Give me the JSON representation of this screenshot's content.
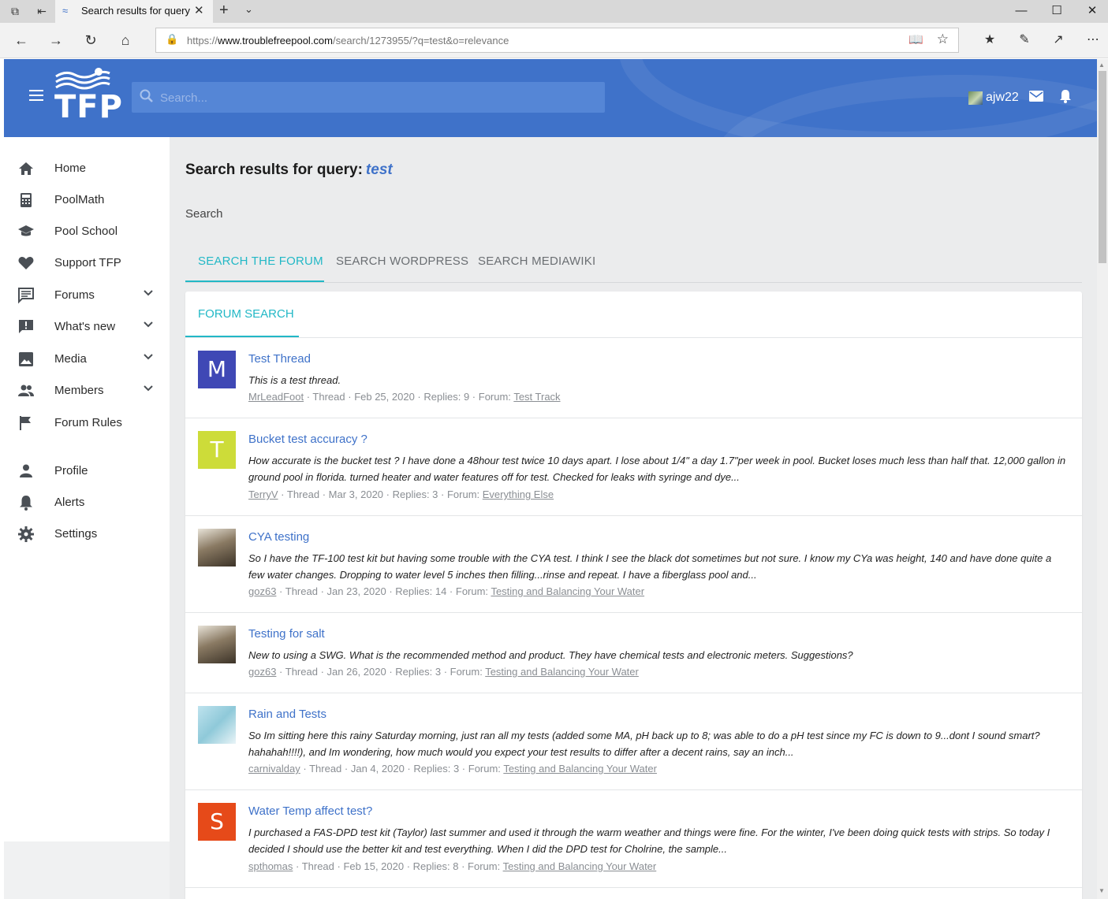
{
  "browser": {
    "tab_title": "Search results for query",
    "url_prefix": "https://",
    "url_domain": "www.troublefreepool.com",
    "url_path": "/search/1273955/?q=test&o=relevance"
  },
  "header": {
    "logo_text": "TFP",
    "search_placeholder": "Search...",
    "username": "ajw22"
  },
  "sidebar": {
    "items": [
      {
        "label": "Home",
        "icon": "home-icon"
      },
      {
        "label": "PoolMath",
        "icon": "calculator-icon"
      },
      {
        "label": "Pool School",
        "icon": "graduation-cap-icon"
      },
      {
        "label": "Support TFP",
        "icon": "heart-icon"
      },
      {
        "label": "Forums",
        "icon": "forum-icon"
      },
      {
        "label": "What's new",
        "icon": "whats-new-icon"
      },
      {
        "label": "Media",
        "icon": "image-icon"
      },
      {
        "label": "Members",
        "icon": "members-icon"
      },
      {
        "label": "Forum Rules",
        "icon": "flag-icon"
      },
      {
        "label": "Profile",
        "icon": "person-icon"
      },
      {
        "label": "Alerts",
        "icon": "bell-icon"
      },
      {
        "label": "Settings",
        "icon": "gear-icon"
      }
    ]
  },
  "main": {
    "title": "Search results for query:",
    "query": "test",
    "search_label": "Search",
    "tabs": [
      "SEARCH THE FORUM",
      "SEARCH WORDPRESS",
      "SEARCH MEDIAWIKI"
    ],
    "panel_tab": "FORUM SEARCH"
  },
  "results": [
    {
      "avatar_letter": "M",
      "avatar_color": "#3f48b5",
      "title": "Test Thread",
      "snippet": "This is a test thread.",
      "author": "MrLeadFoot",
      "type": "Thread",
      "date": "Feb 25, 2020",
      "replies": "Replies: 9",
      "forum_label": "Forum:",
      "forum": "Test Track"
    },
    {
      "avatar_letter": "T",
      "avatar_color": "#cddc39",
      "title": "Bucket test accuracy ?",
      "snippet": "How accurate is the bucket test ? I have done a 48hour test twice 10 days apart. I lose about 1/4\" a day 1.7\"per week in pool. Bucket loses much less than half that. 12,000 gallon in ground pool in florida. turned heater and water features off for test. Checked for leaks with syringe and dye...",
      "author": "TerryV",
      "type": "Thread",
      "date": "Mar 3, 2020",
      "replies": "Replies: 3",
      "forum_label": "Forum:",
      "forum": "Everything Else"
    },
    {
      "avatar_letter": "",
      "avatar_color": "#6b5b45",
      "title": "CYA testing",
      "snippet": "So I have the TF-100 test kit but having some trouble with the CYA test. I think I see the black dot sometimes but not sure. I know my CYa was height, 140 and have done quite a few water changes. Dropping to water level 5 inches then filling...rinse and repeat. I have a fiberglass pool and...",
      "author": "goz63",
      "type": "Thread",
      "date": "Jan 23, 2020",
      "replies": "Replies: 14",
      "forum_label": "Forum:",
      "forum": "Testing and Balancing Your Water"
    },
    {
      "avatar_letter": "",
      "avatar_color": "#6b5b45",
      "title": "Testing for salt",
      "snippet": "New to using a SWG. What is the recommended method and product. They have chemical tests and electronic meters. Suggestions?",
      "author": "goz63",
      "type": "Thread",
      "date": "Jan 26, 2020",
      "replies": "Replies: 3",
      "forum_label": "Forum:",
      "forum": "Testing and Balancing Your Water"
    },
    {
      "avatar_letter": "",
      "avatar_color": "#8fc9d9",
      "title": "Rain and Tests",
      "snippet": "So Im sitting here this rainy Saturday morning, just ran all my tests (added some MA, pH back up to 8; was able to do a pH test since my FC is down to 9...dont I sound smart? hahahah!!!!), and Im wondering, how much would you expect your test results to differ after a decent rains, say an inch...",
      "author": "carnivalday",
      "type": "Thread",
      "date": "Jan 4, 2020",
      "replies": "Replies: 3",
      "forum_label": "Forum:",
      "forum": "Testing and Balancing Your Water"
    },
    {
      "avatar_letter": "S",
      "avatar_color": "#e64a19",
      "title": "Water Temp affect test?",
      "snippet": "I purchased a FAS-DPD test kit (Taylor) last summer and used it through the warm weather and things were fine. For the winter, I've been doing quick tests with strips. So today I decided I should use the better kit and test everything. When I did the DPD test for Cholrine, the sample...",
      "author": "spthomas",
      "type": "Thread",
      "date": "Feb 15, 2020",
      "replies": "Replies: 8",
      "forum_label": "Forum:",
      "forum": "Testing and Balancing Your Water"
    }
  ]
}
